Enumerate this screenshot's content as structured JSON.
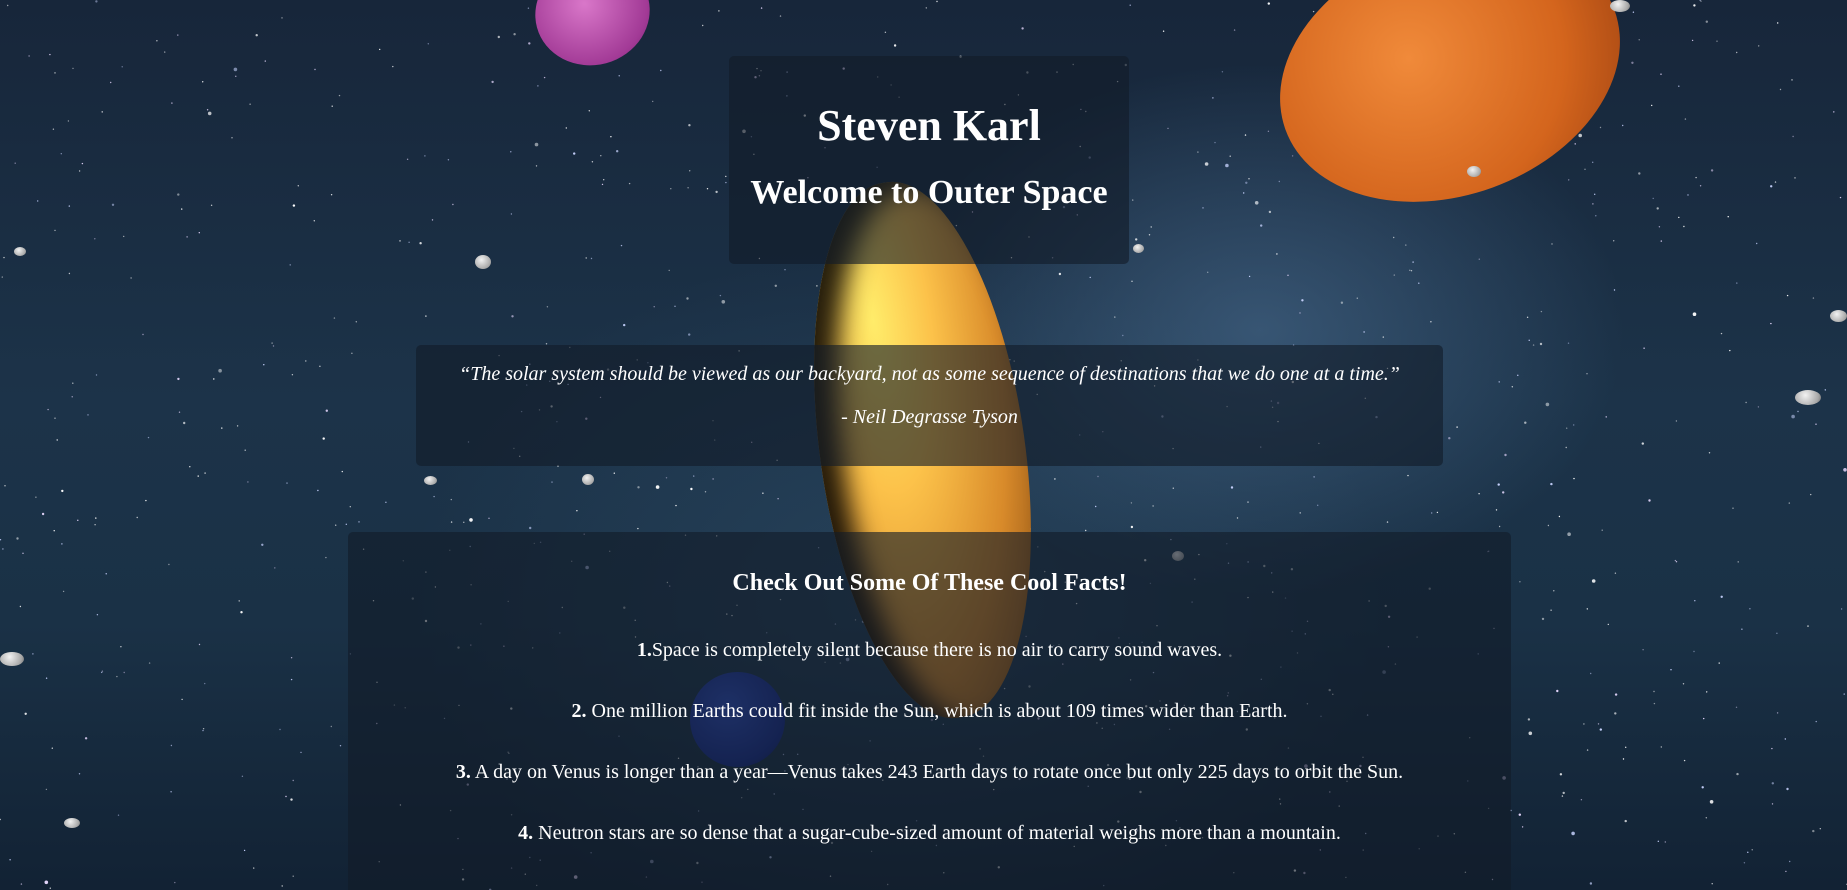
{
  "header": {
    "title": "Steven Karl",
    "subtitle": "Welcome to Outer Space"
  },
  "quote": {
    "text": "“The solar system should be viewed as our backyard, not as some sequence of destinations that we do one at a time.”",
    "author": "- Neil Degrasse Tyson"
  },
  "facts": {
    "heading": "Check Out Some Of These Cool Facts!",
    "items": [
      {
        "number": "1.",
        "text": "Space is completely silent because there is no air to carry sound waves."
      },
      {
        "number": "2.",
        "text": " One million Earths could fit inside the Sun, which is about 109 times wider than Earth."
      },
      {
        "number": "3.",
        "text": " A day on Venus is longer than a year—Venus takes 243 Earth days to rotate once but only 225 days to orbit the Sun."
      },
      {
        "number": "4.",
        "text": " Neutron stars are so dense that a sugar-cube-sized amount of material weighs more than a mountain."
      }
    ]
  },
  "colors": {
    "panel_background": "#121c28",
    "text": "#ffffff",
    "space_background": "#1c3349"
  }
}
